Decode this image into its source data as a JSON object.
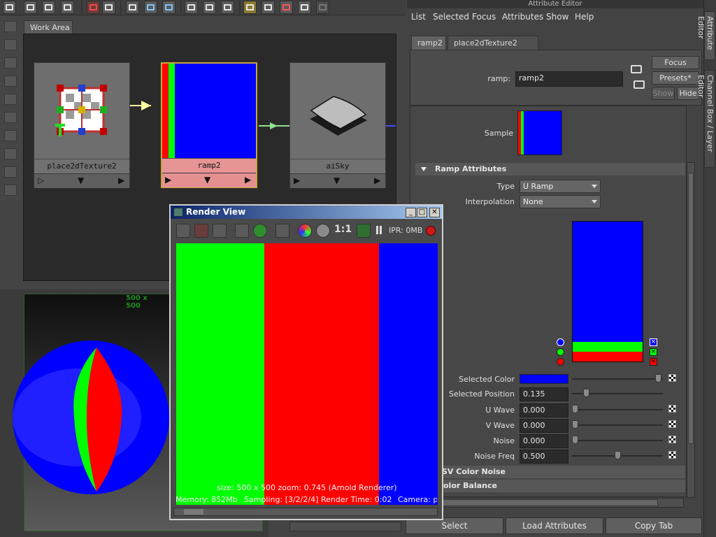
{
  "colors": {
    "green": "#00ff00",
    "red": "#ff0000",
    "blue": "#0000ff",
    "selection_gold": "#c9a43a"
  },
  "toolbar": {
    "icons": [
      "layout-icon",
      "single-pane-icon",
      "two-pane-icon",
      "split-pane-icon",
      "graph-icon",
      "eraser-icon",
      "arrange-icon",
      "network-icon",
      "input-connections-icon",
      "both-connections-icon",
      "output-connections-icon",
      "swatch-icon",
      "list-icon",
      "render-icon",
      "ipr-icon"
    ]
  },
  "work_area": {
    "tab_label": "Work Area",
    "nodes": [
      {
        "label": "place2dTexture2",
        "port_left": "▷",
        "port_mid": "▼",
        "port_right": "▶"
      },
      {
        "label": "ramp2",
        "port_left": "▶",
        "port_mid": "▼",
        "port_right": "▶"
      },
      {
        "label": "aiSky",
        "port_left": "▶",
        "port_mid": "▼",
        "port_right": "▶"
      }
    ]
  },
  "viewport": {
    "resolution_gate": "500 x 500"
  },
  "attribute_editor": {
    "window_title": "Attribute Editor",
    "menu": [
      "List",
      "Selected",
      "Focus",
      "Attributes",
      "Show",
      "Help"
    ],
    "tabs": [
      "ramp2",
      "place2dTexture2"
    ],
    "node_label": "ramp:",
    "node_name": "ramp2",
    "buttons": {
      "focus": "Focus",
      "presets": "Presets*",
      "show": "Show",
      "hide": "Hide"
    },
    "sample_label": "Sample",
    "section_ramp": "Ramp Attributes",
    "type_label": "Type",
    "type_value": "U Ramp",
    "interpolation_label": "Interpolation",
    "interpolation_value": "None",
    "selected_color_label": "Selected Color",
    "selected_position_label": "Selected Position",
    "selected_position_value": "0.135",
    "u_wave_label": "U Wave",
    "u_wave_value": "0.000",
    "v_wave_label": "V Wave",
    "v_wave_value": "0.000",
    "noise_label": "Noise",
    "noise_value": "0.000",
    "noise_freq_label": "Noise Freq",
    "noise_freq_value": "0.500",
    "section_hsv": "SV Color Noise",
    "section_balance": "olor Balance",
    "sliders": {
      "selected_position": 0.135,
      "u_wave": 0.0,
      "v_wave": 0.0,
      "noise": 0.0,
      "noise_freq": 0.5
    }
  },
  "dock": {
    "attribute_editor_tab": "Attribute Editor",
    "channel_box_tab": "Channel Box / Layer Editor"
  },
  "render_view": {
    "title": "Render View",
    "ratio_label": "1:1",
    "ipr_label": "IPR: 0MB",
    "info_line1": "size: 500 x 500  zoom: 0.745    (Arnold Renderer)",
    "info_memory": "Memory: 852Mb",
    "info_sampling": "Sampling: [3/2/2/4]",
    "info_time": "Render Time: 0:02",
    "info_camera": "Camera: pe"
  },
  "bottom_bar": {
    "select": "Select",
    "load_attributes": "Load Attributes",
    "copy_tab": "Copy Tab"
  }
}
